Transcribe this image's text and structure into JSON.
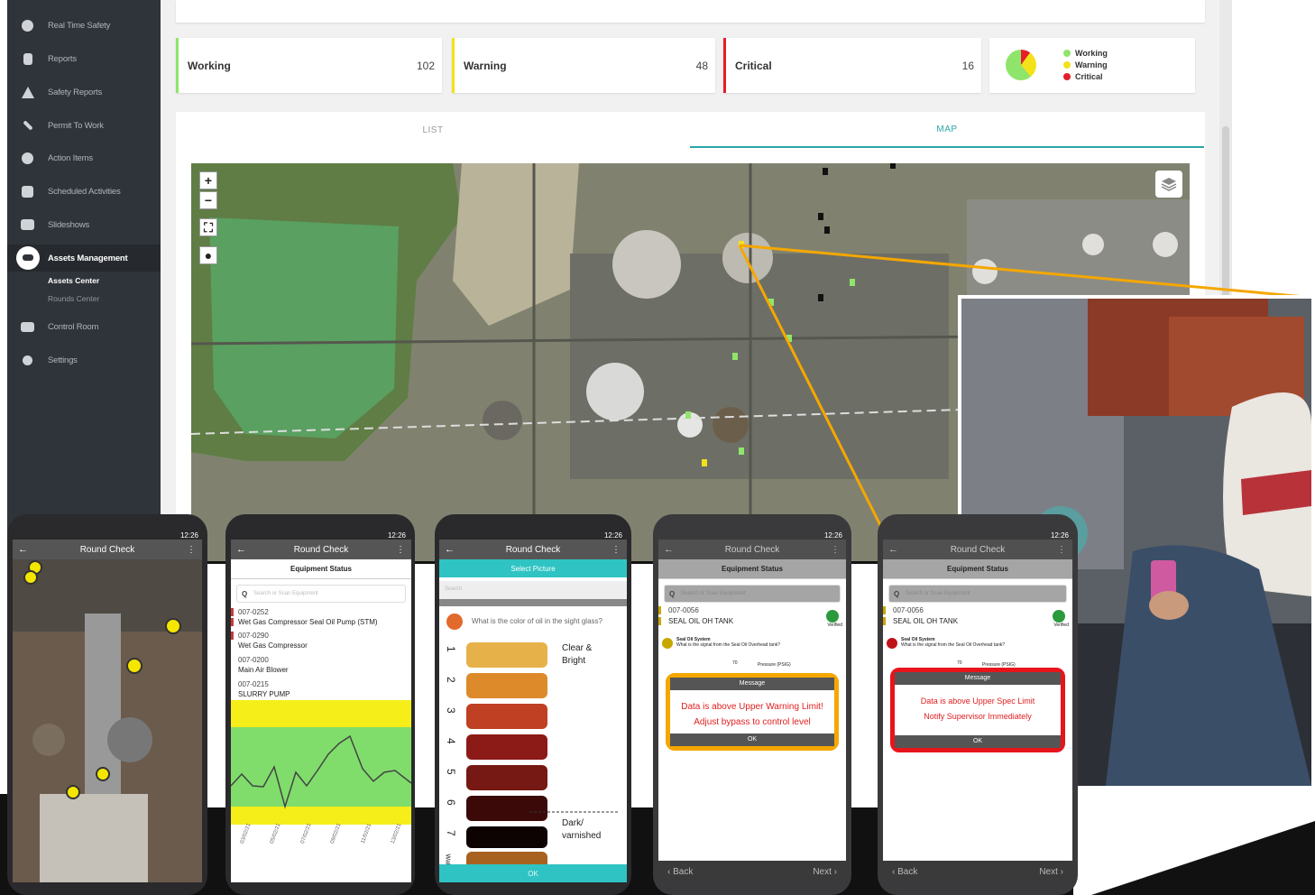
{
  "sidebar": {
    "items": [
      {
        "label": "Real Time Safety",
        "icon": "pie-chart-icon"
      },
      {
        "label": "Reports",
        "icon": "clipboard-icon"
      },
      {
        "label": "Safety Reports",
        "icon": "warning-icon"
      },
      {
        "label": "Permit To Work",
        "icon": "tools-icon"
      },
      {
        "label": "Action Items",
        "icon": "info-icon"
      },
      {
        "label": "Scheduled Activities",
        "icon": "calendar-icon"
      },
      {
        "label": "Slideshows",
        "icon": "slides-icon"
      },
      {
        "label": "Assets Management",
        "icon": "assets-icon"
      },
      {
        "label": "Control Room",
        "icon": "monitor-icon"
      },
      {
        "label": "Settings",
        "icon": "gear-icon"
      }
    ],
    "subitems": [
      {
        "label": "Assets Center"
      },
      {
        "label": "Rounds Center"
      }
    ]
  },
  "stats": [
    {
      "label": "Working",
      "value": "102",
      "color": "#8fe56b"
    },
    {
      "label": "Warning",
      "value": "48",
      "color": "#f3e21a"
    },
    {
      "label": "Critical",
      "value": "16",
      "color": "#e51e2b"
    }
  ],
  "legend": [
    {
      "label": "Working",
      "color": "#8fe56b"
    },
    {
      "label": "Warning",
      "color": "#f3e21a"
    },
    {
      "label": "Critical",
      "color": "#e51e2b"
    }
  ],
  "tabs": {
    "list": "LIST",
    "map": "MAP"
  },
  "map": {
    "zoom_in": "+",
    "zoom_out": "−"
  },
  "phones": {
    "time": "12:26",
    "p1": {
      "title": "Round Check"
    },
    "p2": {
      "title": "Round Check",
      "subtitle": "Equipment Status",
      "search": "Search or Scan Equipment",
      "items": [
        {
          "code": "007-0252",
          "name": "Wet Gas Compressor Seal Oil Pump (STM)"
        },
        {
          "code": "007-0290",
          "name": "Wet Gas Compressor"
        },
        {
          "code": "007-0200",
          "name": "Main Air Blower"
        },
        {
          "code": "007-0215",
          "name": "SLURRY PUMP"
        }
      ],
      "dates": [
        "03/02/21",
        "05/02/21",
        "07/02/21",
        "09/02/21",
        "11/02/21",
        "13/02/21"
      ]
    },
    "p3": {
      "title": "Round Check",
      "subtitle": "Select Picture",
      "search": "Search",
      "question": "What is the color of oil in the sight glass?",
      "top_label": "Clear & Bright",
      "bottom_label": "Dark/ varnished",
      "scale": [
        "1",
        "2",
        "3",
        "4",
        "5",
        "6",
        "7",
        "Watery"
      ],
      "ok": "OK"
    },
    "p4": {
      "title": "Round Check",
      "subtitle": "Equipment Status",
      "search": "Search or Scan Equipment",
      "code": "007-0056",
      "name": "SEAL OIL OH TANK",
      "verified": "Verified",
      "system": "Seal Oil System",
      "question": "What is the signal from the Seal Oil Overhead tank?",
      "reading": "70",
      "unit": "Pressure (PSIG)",
      "msg_title": "Message",
      "msg_line1": "Data is above Upper Warning Limit!",
      "msg_line2": "Adjust bypass to control level",
      "ok": "OK",
      "back": "‹ Back",
      "next": "Next ›",
      "accent": "#f5a700"
    },
    "p5": {
      "title": "Round Check",
      "subtitle": "Equipment Status",
      "search": "Search or Scan Equipment",
      "code": "007-0056",
      "name": "SEAL OIL OH TANK",
      "verified": "Verified",
      "system": "Seal Oil System",
      "question": "What is the signal from the Seal Oil Overhead tank?",
      "reading": "70",
      "unit": "Pressure (PSIG)",
      "msg_title": "Message",
      "msg_line1": "Data is above Upper Spec Limit",
      "msg_line2": "Notify Supervisor Immediately",
      "ok": "OK",
      "back": "‹ Back",
      "next": "Next ›",
      "accent": "#e8141b"
    }
  }
}
